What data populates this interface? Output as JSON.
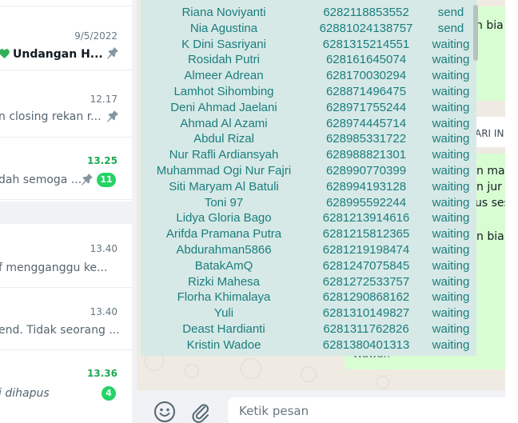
{
  "chat_list": {
    "items": [
      {
        "time": "9/5/2022",
        "time_unread": false,
        "name": "Undangan H...",
        "has_heart": true,
        "preview": "",
        "pinned": true,
        "unread": ""
      },
      {
        "time": "12.17",
        "time_unread": false,
        "name": "",
        "has_heart": false,
        "preview": "n closing rekan r...",
        "pinned": true,
        "unread": ""
      },
      {
        "time": "13.25",
        "time_unread": true,
        "name": "",
        "has_heart": false,
        "preview": "dah semoga ...",
        "pinned": true,
        "unread": "11"
      },
      {
        "time": "13.40",
        "time_unread": false,
        "name": "",
        "has_heart": false,
        "preview": "f mengganggu ke...",
        "pinned": false,
        "unread": ""
      },
      {
        "time": "13.40",
        "time_unread": false,
        "name": "",
        "has_heart": false,
        "preview": "end. Tidak seorang ...",
        "pinned": false,
        "unread": ""
      },
      {
        "time": "13.36",
        "time_unread": true,
        "name": "",
        "has_heart": false,
        "preview": "i dihapus",
        "pinned": false,
        "unread": "4"
      }
    ]
  },
  "conversation": {
    "bubble_fragments": [
      "n bia",
      "ARI IN",
      "n ma",
      "n jur",
      "us ses",
      "n bia",
      "Wawan"
    ]
  },
  "contacts": [
    {
      "name": "Riana Noviyanti",
      "phone": "6282118853552",
      "status": "send"
    },
    {
      "name": "Nia Agustina",
      "phone": "62881024138757",
      "status": "send"
    },
    {
      "name": "K Dini Sasriyani",
      "phone": "6281315214551",
      "status": "waiting"
    },
    {
      "name": "Rosidah Putri",
      "phone": "628161645074",
      "status": "waiting"
    },
    {
      "name": "Almeer Adrean",
      "phone": "628170030294",
      "status": "waiting"
    },
    {
      "name": "Lamhot Sihombing",
      "phone": "628871496475",
      "status": "waiting"
    },
    {
      "name": "Deni Ahmad Jaelani",
      "phone": "628971755244",
      "status": "waiting"
    },
    {
      "name": "Ahmad Al Azami",
      "phone": "628974445714",
      "status": "waiting"
    },
    {
      "name": "Abdul Rizal",
      "phone": "628985331722",
      "status": "waiting"
    },
    {
      "name": "Nur Rafli Ardiansyah",
      "phone": "628988821301",
      "status": "waiting"
    },
    {
      "name": "Muhammad Ogi Nur Fajri",
      "phone": "628990770399",
      "status": "waiting"
    },
    {
      "name": "Siti Maryam Al Batuli",
      "phone": "628994193128",
      "status": "waiting"
    },
    {
      "name": "Toni 97",
      "phone": "628995592244",
      "status": "waiting"
    },
    {
      "name": "Lidya Gloria Bago",
      "phone": "6281213914616",
      "status": "waiting"
    },
    {
      "name": "Arifda Pramana Putra",
      "phone": "6281215812365",
      "status": "waiting"
    },
    {
      "name": "Abdurahman5866",
      "phone": "6281219198474",
      "status": "waiting"
    },
    {
      "name": "BatakAmQ",
      "phone": "6281247075845",
      "status": "waiting"
    },
    {
      "name": "Rizki Mahesa",
      "phone": "6281272533757",
      "status": "waiting"
    },
    {
      "name": "Florha Khimalaya",
      "phone": "6281290868162",
      "status": "waiting"
    },
    {
      "name": "Yuli",
      "phone": "6281310149827",
      "status": "waiting"
    },
    {
      "name": "Deast Hardianti",
      "phone": "6281311762826",
      "status": "waiting"
    },
    {
      "name": "Kristin Wadoe",
      "phone": "6281380401313",
      "status": "waiting"
    }
  ],
  "footer": {
    "input_placeholder": "Ketik pesan",
    "emoji_icon": "emoji-icon",
    "attach_icon": "paperclip-icon"
  },
  "colors": {
    "table_bg": "#d6e9e7",
    "table_text": "#1b7d7d",
    "unread_green": "#25d366",
    "outgoing_bubble": "#d9fdd3"
  }
}
